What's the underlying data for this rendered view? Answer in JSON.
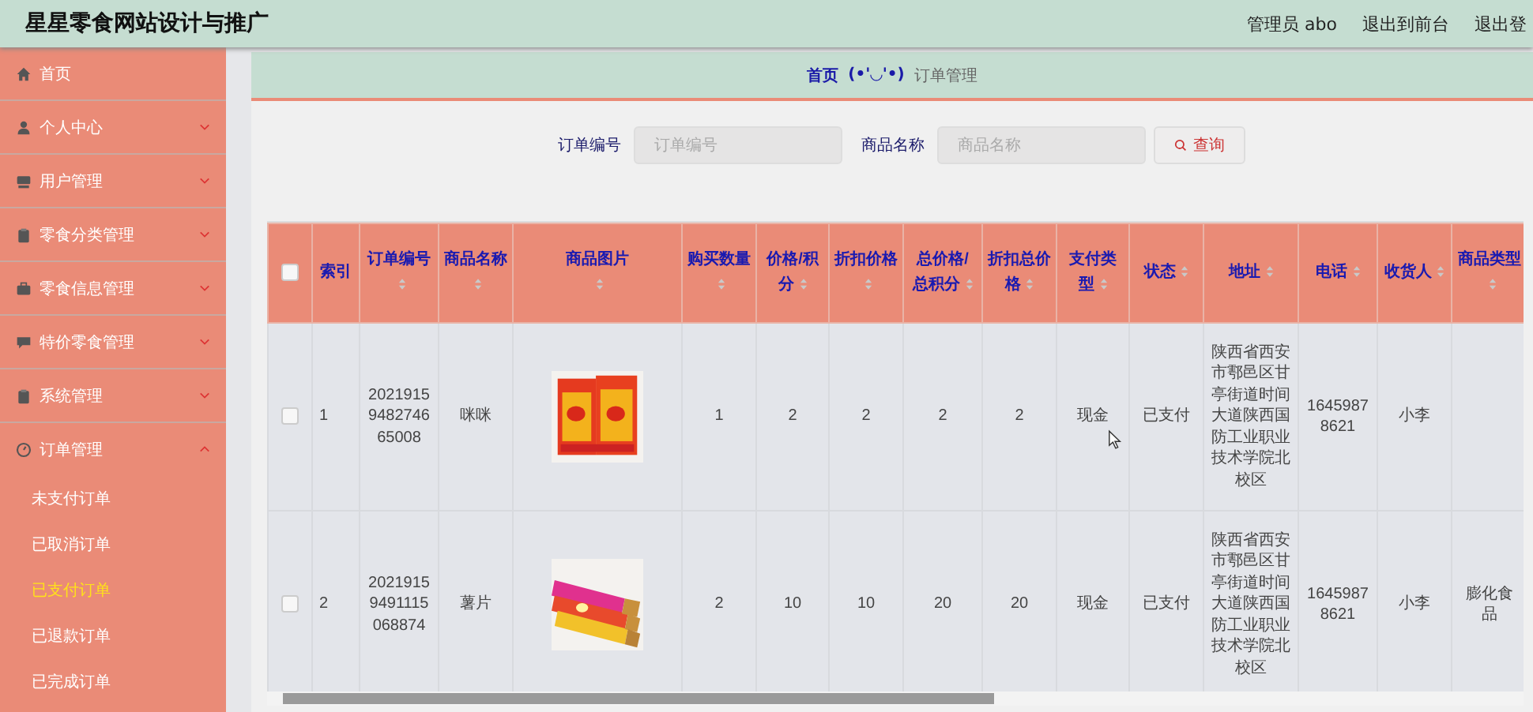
{
  "header": {
    "title": "星星零食网站设计与推广",
    "user": "管理员 abo",
    "links": [
      "退出到前台",
      "退出登"
    ]
  },
  "sidebar": {
    "items": [
      {
        "label": "首页",
        "expanded": false,
        "has_caret": false
      },
      {
        "label": "个人中心",
        "expanded": false,
        "has_caret": true
      },
      {
        "label": "用户管理",
        "expanded": false,
        "has_caret": true
      },
      {
        "label": "零食分类管理",
        "expanded": false,
        "has_caret": true
      },
      {
        "label": "零食信息管理",
        "expanded": false,
        "has_caret": true
      },
      {
        "label": "特价零食管理",
        "expanded": false,
        "has_caret": true
      },
      {
        "label": "系统管理",
        "expanded": false,
        "has_caret": true
      },
      {
        "label": "订单管理",
        "expanded": true,
        "has_caret": true,
        "children": [
          {
            "label": "未支付订单",
            "selected": false
          },
          {
            "label": "已取消订单",
            "selected": false
          },
          {
            "label": "已支付订单",
            "selected": true
          },
          {
            "label": "已退款订单",
            "selected": false
          },
          {
            "label": "已完成订单",
            "selected": false
          }
        ]
      }
    ]
  },
  "breadcrumb": {
    "home": "首页",
    "separator": "(•'◡'•)",
    "current": "订单管理"
  },
  "search": {
    "fields": [
      {
        "label": "订单编号",
        "placeholder": "订单编号"
      },
      {
        "label": "商品名称",
        "placeholder": "商品名称"
      }
    ],
    "button": "查询"
  },
  "table": {
    "select_all_checked": false,
    "columns": [
      {
        "label": "索引",
        "sortable": false
      },
      {
        "label": "订单编号",
        "sortable": true
      },
      {
        "label": "商品名称",
        "sortable": true
      },
      {
        "label": "商品图片",
        "sortable": true
      },
      {
        "label": "购买数量",
        "sortable": true
      },
      {
        "label": "价格/积分",
        "sortable": true
      },
      {
        "label": "折扣价格",
        "sortable": true
      },
      {
        "label": "总价格/总积分",
        "sortable": true
      },
      {
        "label": "折扣总价格",
        "sortable": true
      },
      {
        "label": "支付类型",
        "sortable": true
      },
      {
        "label": "状态",
        "sortable": true
      },
      {
        "label": "地址",
        "sortable": true
      },
      {
        "label": "电话",
        "sortable": true
      },
      {
        "label": "收货人",
        "sortable": true
      },
      {
        "label": "商品类型",
        "sortable": true
      }
    ],
    "rows": [
      {
        "checked": false,
        "cells": [
          "1",
          "2021915948274665008",
          "咪咪",
          {
            "kind": "picture"
          },
          "1",
          "2",
          "2",
          "2",
          "2",
          "现金",
          "已支付",
          "陕西省西安市鄠邑区甘亭街道时间大道陕西国防工业职业技术学院北校区",
          "16459878621",
          "小李",
          ""
        ]
      },
      {
        "checked": false,
        "cells": [
          "2",
          "20219159491115068874",
          "薯片",
          {
            "kind": "picture"
          },
          "2",
          "10",
          "10",
          "20",
          "20",
          "现金",
          "已支付",
          "陕西省西安市鄠邑区甘亭街道时间大道陕西国防工业职业技术学院北校区",
          "16459878621",
          "小李",
          "膨化食品"
        ]
      }
    ]
  }
}
